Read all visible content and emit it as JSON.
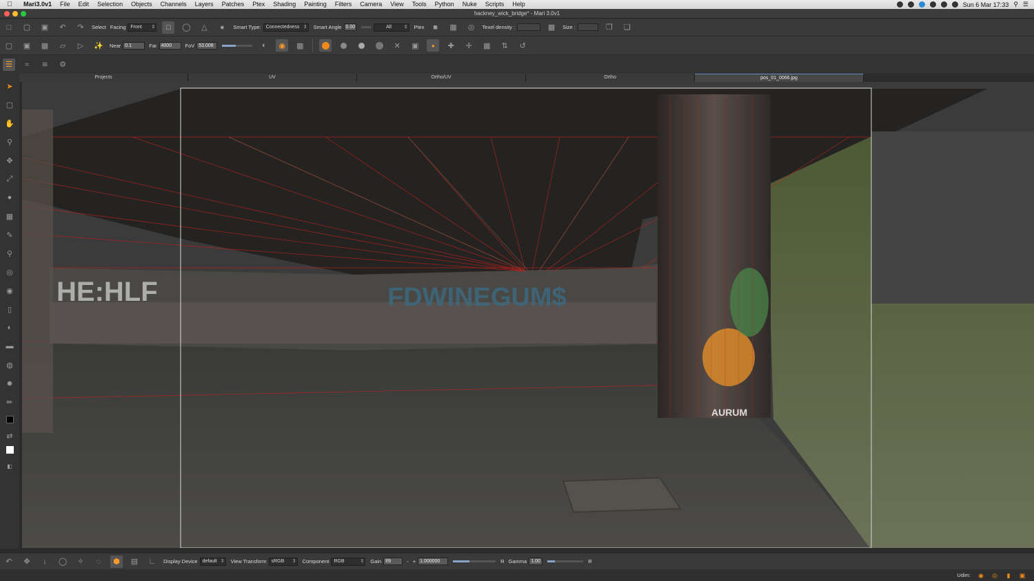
{
  "menubar": {
    "app_name": "Mari3.0v1",
    "items": [
      "File",
      "Edit",
      "Selection",
      "Objects",
      "Channels",
      "Layers",
      "Patches",
      "Ptex",
      "Shading",
      "Painting",
      "Filters",
      "Camera",
      "View",
      "Tools",
      "Python",
      "Nuke",
      "Scripts",
      "Help"
    ],
    "clock": "Sun 6 Mar  17:33"
  },
  "window": {
    "title": "hackney_wick_bridge* - Mari 3.0v1"
  },
  "toolbar1": {
    "select_label": "Select",
    "facing_label": "Facing",
    "facing_value": "Front",
    "smart_type_label": "Smart Type:",
    "smart_type_value": "Connectedness",
    "smart_angle_label": "Smart Angle",
    "smart_angle_value": "0.00",
    "all_value": "All",
    "ptex_label": "Ptex",
    "texel_density_label": "Texel density :",
    "size_label": "Size :"
  },
  "toolbar2": {
    "near_label": "Near",
    "near_value": "0.1",
    "far_label": "Far",
    "far_value": "4000",
    "fov_label": "FoV",
    "fov_value": "53.008"
  },
  "tabs": [
    {
      "label": "Projects"
    },
    {
      "label": "UV"
    },
    {
      "label": "Ortho/UV"
    },
    {
      "label": "Ortho"
    },
    {
      "label": "pos_01_0066.jpg"
    }
  ],
  "active_tab": "pos_01_0066.jpg",
  "viewport": {
    "graffiti_main": "FDWINEGUM$",
    "graffiti_left": "HE:HLF",
    "graffiti_pillar": "AURUM"
  },
  "bottombar": {
    "display_device_label": "Display Device",
    "display_device_value": "default",
    "view_transform_label": "View Transform",
    "view_transform_value": "sRGB",
    "component_label": "Component",
    "component_value": "RGB",
    "gain_label": "Gain",
    "gain_value": "f/8",
    "exposure_value": "1.000000",
    "r_label": "R",
    "gamma_label": "Gamma",
    "gamma_value": "1.00",
    "r2_label": "R"
  },
  "status": {
    "udim_label": "Udim:"
  },
  "colors": {
    "accent": "#f08a1c",
    "wire": "#c0201c"
  }
}
